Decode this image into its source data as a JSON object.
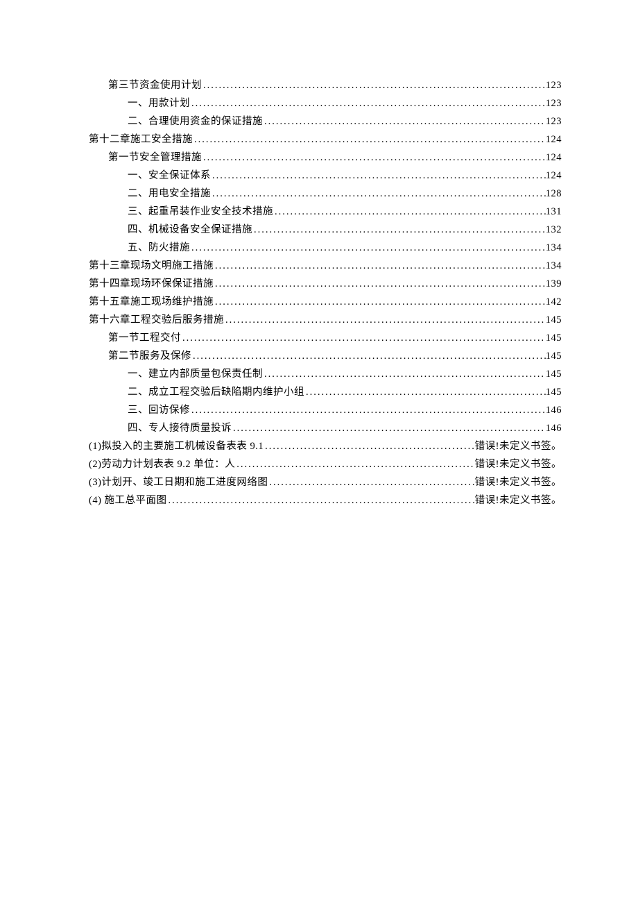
{
  "toc": [
    {
      "level": 2,
      "title": "第三节资金使用计划",
      "page": "123"
    },
    {
      "level": 3,
      "title": "一、用款计划",
      "page": "123"
    },
    {
      "level": 3,
      "title": "二、合理使用资金的保证措施",
      "page": "123"
    },
    {
      "level": 1,
      "title": "第十二章施工安全措施",
      "page": "124"
    },
    {
      "level": 2,
      "title": "第一节安全管理措施",
      "page": "124"
    },
    {
      "level": 3,
      "title": "一、安全保证体系",
      "page": "124"
    },
    {
      "level": 3,
      "title": "二、用电安全措施",
      "page": "128"
    },
    {
      "level": 3,
      "title": "三、起重吊装作业安全技术措施",
      "page": "131"
    },
    {
      "level": 3,
      "title": "四、机械设备安全保证措施",
      "page": "132"
    },
    {
      "level": 3,
      "title": "五、防火措施",
      "page": "134"
    },
    {
      "level": 1,
      "title": "第十三章现场文明施工措施",
      "page": "134"
    },
    {
      "level": 1,
      "title": "第十四章现场环保保证措施",
      "page": "139"
    },
    {
      "level": 1,
      "title": "第十五章施工现场维护措施",
      "page": "142"
    },
    {
      "level": 1,
      "title": "第十六章工程交验后服务措施",
      "page": "145"
    },
    {
      "level": 2,
      "title": "第一节工程交付",
      "page": "145"
    },
    {
      "level": 2,
      "title": "第二节服务及保修",
      "page": "145"
    },
    {
      "level": 3,
      "title": "一、建立内部质量包保责任制",
      "page": "145"
    },
    {
      "level": 3,
      "title": "二、成立工程交验后缺陷期内维护小组",
      "page": "145"
    },
    {
      "level": 3,
      "title": "三、回访保修",
      "page": "146"
    },
    {
      "level": 3,
      "title": "四、专人接待质量投诉",
      "page": "146"
    },
    {
      "level": 1,
      "title": "(1)拟投入的主要施工机械设备表表 9.1 ",
      "page": "错误!未定义书签。"
    },
    {
      "level": 1,
      "title": "(2)劳动力计划表表 9.2 单位：人",
      "page": "错误!未定义书签。"
    },
    {
      "level": 1,
      "title": "(3)计划开、竣工日期和施工进度网络图",
      "page": "错误!未定义书签。"
    },
    {
      "level": 1,
      "title": "(4) 施工总平面图",
      "page": "错误!未定义书签。"
    }
  ]
}
